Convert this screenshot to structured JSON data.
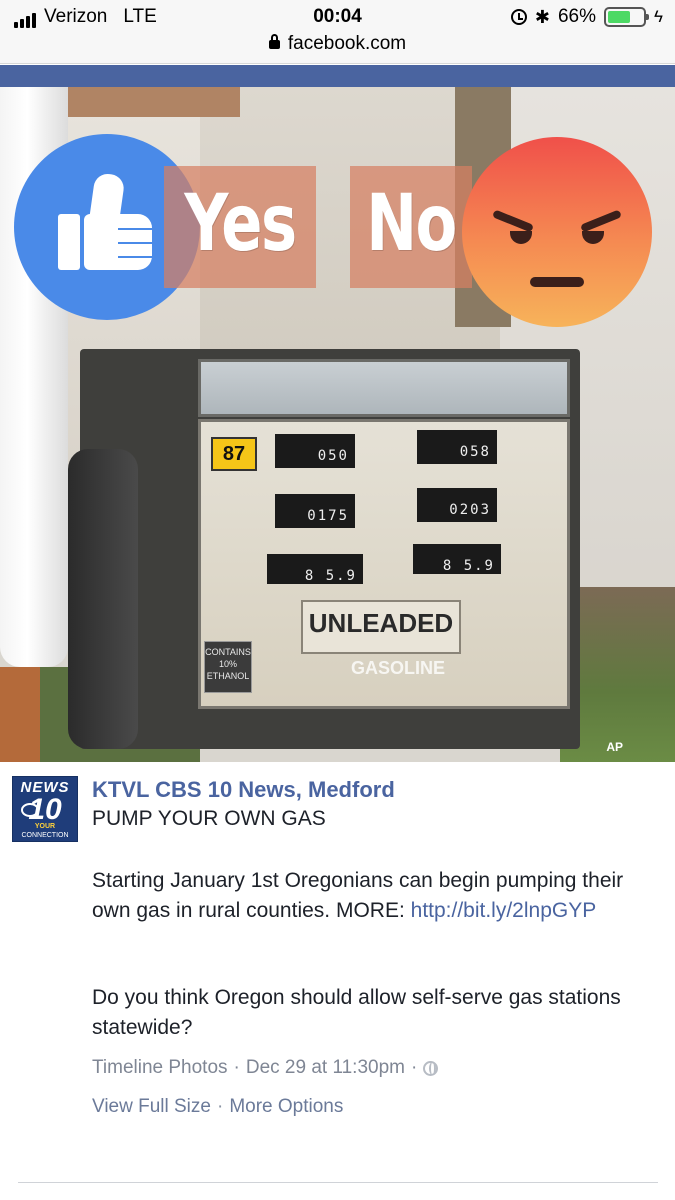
{
  "status_bar": {
    "carrier": "Verizon",
    "network": "LTE",
    "time": "00:04",
    "url": "facebook.com",
    "battery_percent": "66%",
    "battery_level": 0.66
  },
  "colors": {
    "facebook_blue": "#4a64a0",
    "like_blue": "#4a8ae8",
    "vote_box": "#d68062",
    "text_dark": "#1d2129",
    "meta_gray": "#7f8694"
  },
  "image": {
    "overlay_yes": "Yes",
    "overlay_no": "No",
    "price_tag": "87",
    "meter_total_left": "050",
    "meter_gallons_left": "0175",
    "meter_price_left": "8 5.9",
    "meter_total_right": "058",
    "meter_gallons_right": "0203",
    "meter_price_right": "8 5.9",
    "unleaded": "UNLEADED",
    "gasoline": "GASOLINE",
    "ethanol_tag": "CONTAINS 10% ETHANOL",
    "credit": "AP",
    "icons": [
      "like-reaction-icon",
      "angry-reaction-icon"
    ]
  },
  "post": {
    "avatar": {
      "news": "NEWS",
      "channel": "10",
      "your": "YOUR",
      "connection": "CONNECTION"
    },
    "page_name": "KTVL CBS 10 News, Medford",
    "headline": "PUMP YOUR OWN GAS",
    "body": "Starting January 1st Oregonians can begin pumping their own gas in rural counties. MORE: ",
    "link": "http://bit.ly/2lnpGYP",
    "question": "Do you think Oregon should allow self-serve gas stations statewide?",
    "source": "Timeline Photos",
    "separator": "·",
    "timestamp": "Dec 29 at 11:30pm",
    "view_full_size": "View Full Size",
    "more_options": "More Options"
  }
}
